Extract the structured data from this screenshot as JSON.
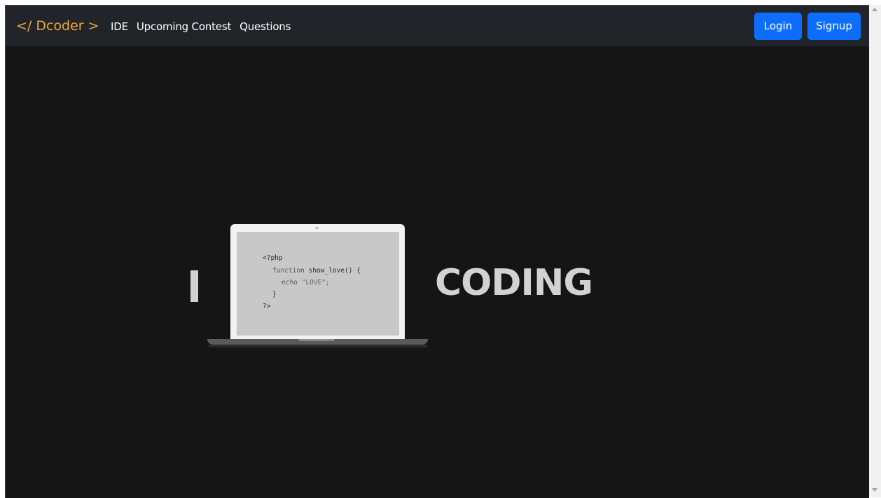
{
  "navbar": {
    "brand": "</ Dcoder >",
    "links": [
      "IDE",
      "Upcoming Contest",
      "Questions"
    ],
    "login_label": "Login",
    "signup_label": "Signup"
  },
  "hero": {
    "left_word": "I",
    "right_word": "CODING",
    "code": {
      "line1": "<?php",
      "line2_kw": "function ",
      "line2_fn": "show_love() {",
      "line3_kw": "echo ",
      "line3_str": "\"LOVE\";",
      "line4": "}",
      "line5": "?>"
    }
  },
  "colors": {
    "brand": "#f0a73b",
    "navbar_bg": "#212529",
    "page_bg": "#151515",
    "button": "#0d6efd"
  }
}
